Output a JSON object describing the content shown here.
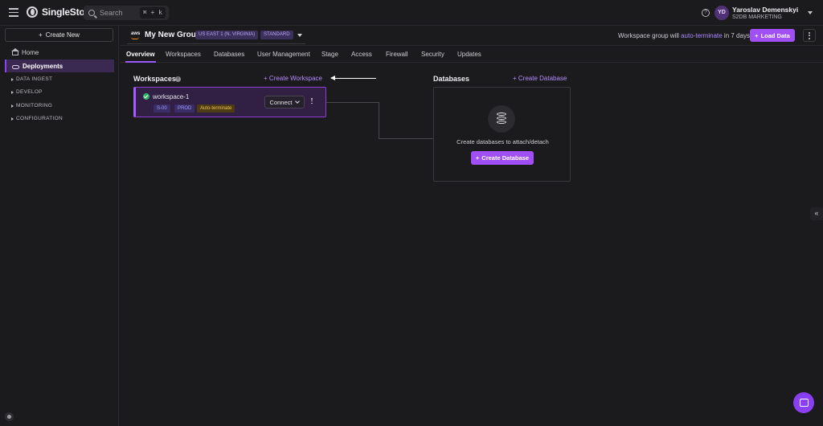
{
  "topbar": {
    "brand": "SingleStore",
    "search_placeholder": "Search",
    "search_shortcut": "⌘ + k",
    "user_initials": "YD",
    "user_name": "Yaroslav Demenskyi",
    "user_org": "S2DB MARKETING"
  },
  "sidebar": {
    "create_new": "Create New",
    "items": [
      {
        "label": "Home",
        "icon": "home-icon"
      },
      {
        "label": "Deployments",
        "icon": "cloud-icon"
      }
    ],
    "sections": [
      "DATA INGEST",
      "DEVELOP",
      "MONITORING",
      "CONFIGURATION"
    ]
  },
  "group": {
    "name": "My New Group",
    "provider_icon": "aws",
    "region": "US EAST 1 (N. VIRGINIA)",
    "tier": "STANDARD",
    "note_prefix": "Workspace group will ",
    "note_link": "auto-terminate",
    "note_suffix": " in 7 days.",
    "load_data": "Load Data"
  },
  "tabs": [
    "Overview",
    "Workspaces",
    "Databases",
    "User Management",
    "Stage",
    "Access",
    "Firewall",
    "Security",
    "Updates"
  ],
  "active_tab": "Overview",
  "workspaces": {
    "title": "Workspaces",
    "create_label": "Create Workspace",
    "items": [
      {
        "name": "workspace-1",
        "size": "S-00",
        "env": "PROD",
        "status_badge": "Auto-terminate",
        "connect": "Connect"
      }
    ]
  },
  "databases": {
    "title": "Databases",
    "create_link": "Create Database",
    "empty_text": "Create databases to attach/detach",
    "create_button": "Create Database"
  },
  "colors": {
    "accent": "#a04ff5",
    "background": "#1b1a1c",
    "success": "#2fb36b"
  }
}
